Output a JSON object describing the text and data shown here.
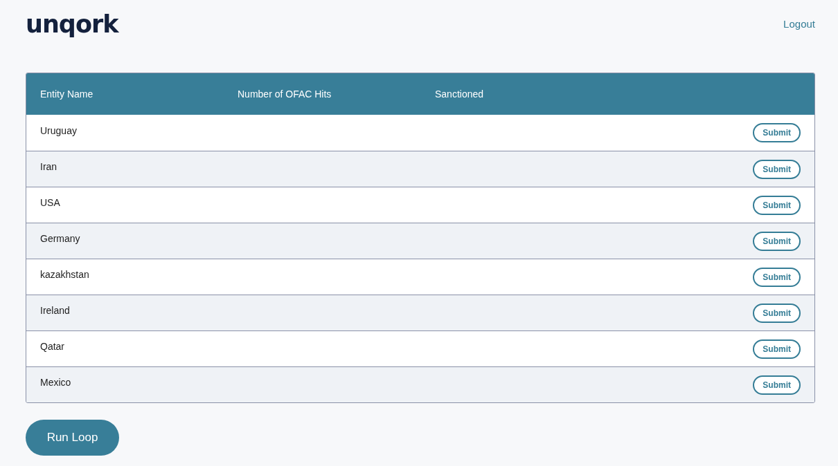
{
  "header": {
    "logo": "unqork",
    "logout": "Logout"
  },
  "table": {
    "columns": [
      "Entity Name",
      "Number of OFAC Hits",
      "Sanctioned"
    ],
    "rows": [
      {
        "entity_name": "Uruguay",
        "action": "Submit"
      },
      {
        "entity_name": "Iran",
        "action": "Submit"
      },
      {
        "entity_name": "USA",
        "action": "Submit"
      },
      {
        "entity_name": "Germany",
        "action": "Submit"
      },
      {
        "entity_name": "kazakhstan",
        "action": "Submit"
      },
      {
        "entity_name": "Ireland",
        "action": "Submit"
      },
      {
        "entity_name": "Qatar",
        "action": "Submit"
      },
      {
        "entity_name": "Mexico",
        "action": "Submit"
      }
    ]
  },
  "run_button": "Run Loop"
}
